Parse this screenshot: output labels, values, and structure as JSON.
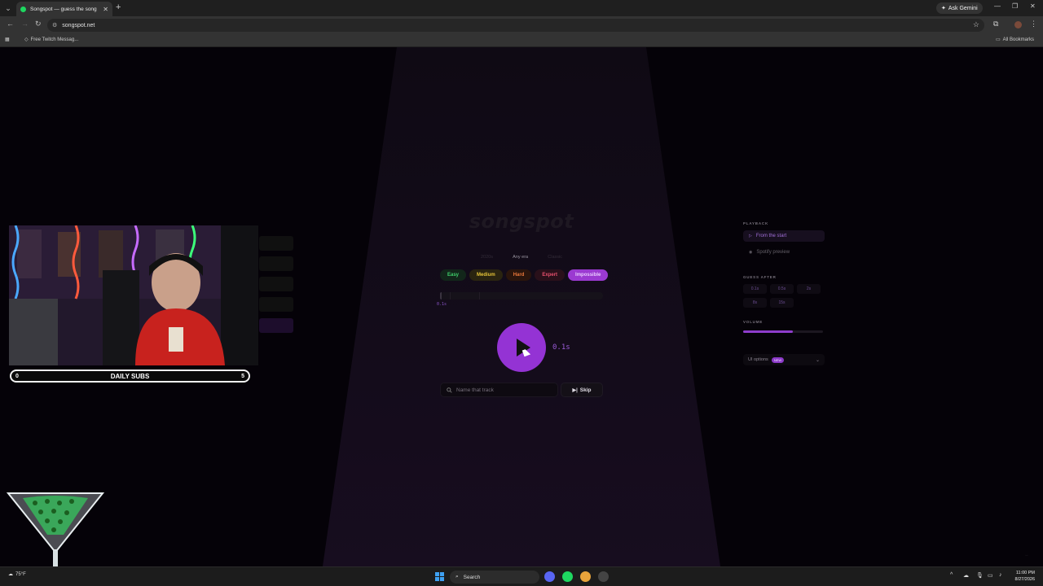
{
  "browser": {
    "tab_title": "Songspot — guess the song",
    "url": "songspot.net",
    "ask_gemini": "Ask Gemini",
    "bookmark": "Free Twitch Messag...",
    "all_bookmarks": "All Bookmarks"
  },
  "app": {
    "logo": "songspot",
    "eras": [
      "2020s",
      "Any era",
      "Classic"
    ],
    "active_era": "Any era",
    "difficulties": [
      "Easy",
      "Medium",
      "Hard",
      "Expert",
      "Impossible"
    ],
    "selected_difficulty": "Impossible",
    "progress_label": "0.1s",
    "play_time": "0.1s",
    "guess_placeholder": "Name that track",
    "skip_label": "Skip"
  },
  "panel": {
    "playback_heading": "PLAYBACK",
    "playback_options": [
      "From the start",
      "Spotify preview"
    ],
    "selected_playback": "From the start",
    "guess_after_heading": "GUESS AFTER",
    "guess_after_options": [
      "0.1s",
      "0.5s",
      "2s",
      "8s",
      "15s"
    ],
    "volume_heading": "VOLUME",
    "volume_level": 0.62,
    "ui_options_label": "UI options",
    "ui_options_badge": "NEW"
  },
  "stream": {
    "subs_left": "0",
    "subs_title": "DAILY SUBS",
    "subs_right": "5"
  },
  "taskbar": {
    "weather": "75°F",
    "search": "Search",
    "time": "11:00 PM",
    "date": "8/27/2026"
  },
  "colors": {
    "accent": "#9433d4",
    "page_bg": "#050208"
  }
}
